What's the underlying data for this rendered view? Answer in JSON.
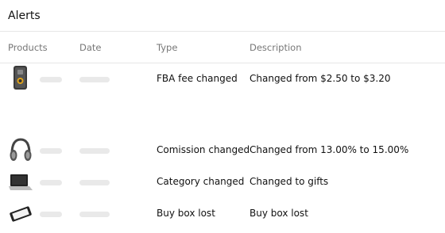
{
  "alerts": {
    "title": "Alerts",
    "columns": [
      "Products",
      "Date",
      "Type",
      "Description"
    ],
    "rows": [
      {
        "product_icon": "speaker-device-icon",
        "type": "FBA fee changed",
        "description": "Changed from $2.50 to $3.20"
      },
      {
        "product_icon": "headphones-icon",
        "type": "Comission changed",
        "description": "Changed from 13.00% to 15.00%"
      },
      {
        "product_icon": "laptop-icon",
        "type": "Category changed",
        "description": "Changed to gifts"
      },
      {
        "product_icon": "phone-icon",
        "type": "Buy box lost",
        "description": "Buy box lost"
      }
    ]
  }
}
